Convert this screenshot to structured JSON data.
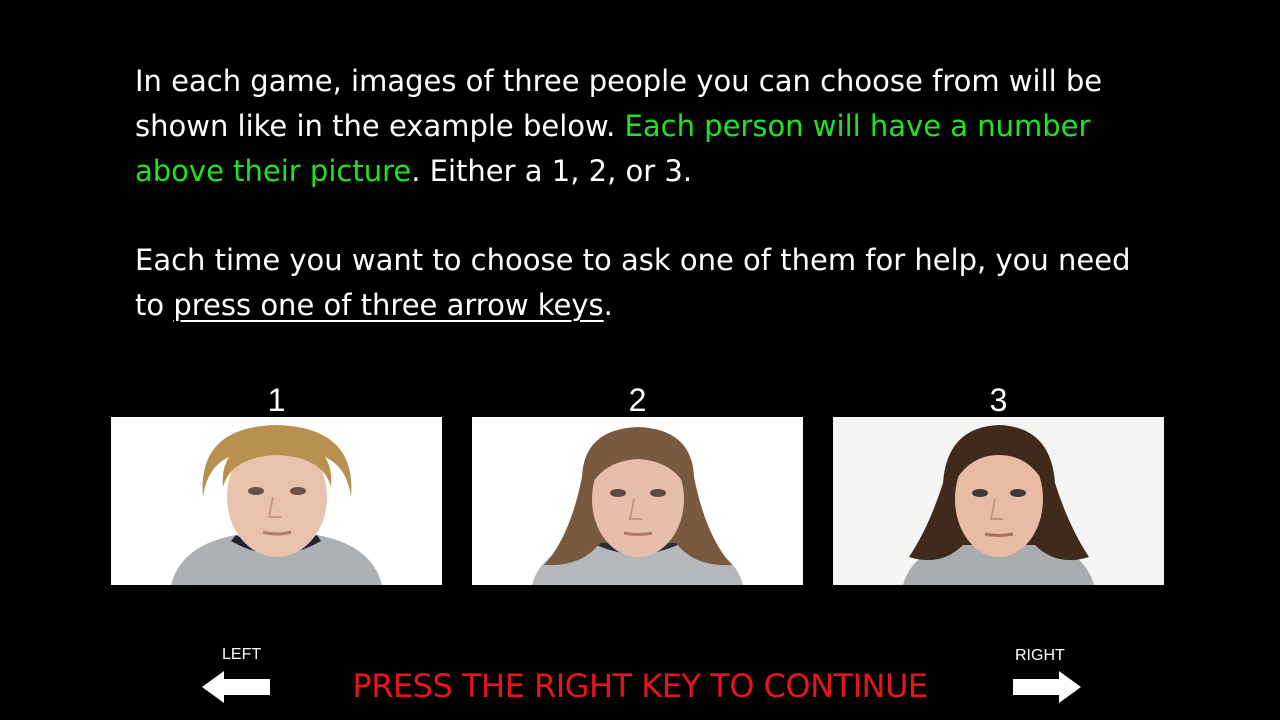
{
  "instructions": {
    "p1_white_1": "In each game, images of three people you can choose from will be shown like in the example below. ",
    "p1_green": "Each person will have a number above their picture",
    "p1_white_2": ". Either a 1, 2, or 3.",
    "p2_white_1": "Each time you want to choose to ask one of them for help, you need to ",
    "p2_underlined": "press one of three arrow keys",
    "p2_white_2": "."
  },
  "people": [
    {
      "number": "1",
      "hair": "#b8904f"
    },
    {
      "number": "2",
      "hair": "#7a5a3e"
    },
    {
      "number": "3",
      "hair": "#3f2a1c"
    }
  ],
  "keys": {
    "left_label": "LEFT",
    "right_label": "RIGHT",
    "left_icon": "arrow-left-icon",
    "right_icon": "arrow-right-icon"
  },
  "continue_prompt": "PRESS THE RIGHT KEY TO CONTINUE",
  "colors": {
    "background": "#000000",
    "text": "#ffffff",
    "highlight": "#22e322",
    "prompt": "#e8141b"
  }
}
